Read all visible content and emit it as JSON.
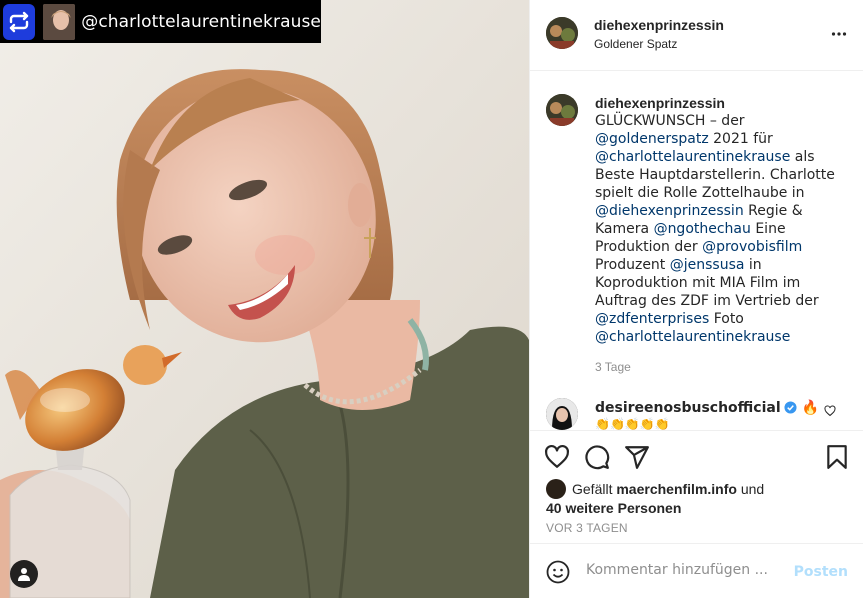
{
  "photo": {
    "repost_handle": "@charlottelaurentinekrause",
    "icons": {
      "repost": "repost-icon",
      "user_tag": "user-icon"
    }
  },
  "header": {
    "username": "diehexenprinzessin",
    "location": "Goldener Spatz",
    "more_icon": "more-horizontal-icon"
  },
  "caption": {
    "username": "diehexenprinzessin",
    "segments": [
      {
        "text": "GLÜCKWUNSCH – der ",
        "mention": false
      },
      {
        "text": "@goldenerspatz",
        "mention": true
      },
      {
        "text": " 2021 für ",
        "mention": false
      },
      {
        "text": "@charlottelaurentinekrause",
        "mention": true
      },
      {
        "text": " als Beste Hauptdarstellerin. Charlotte spielt die Rolle Zottelhaube in ",
        "mention": false
      },
      {
        "text": "@diehexenprinzessin",
        "mention": true
      },
      {
        "text": " Regie & Kamera ",
        "mention": false
      },
      {
        "text": "@ngothechau",
        "mention": true
      },
      {
        "text": " Eine Produktion der ",
        "mention": false
      },
      {
        "text": "@provobisfilm",
        "mention": true
      },
      {
        "text": " Produzent ",
        "mention": false
      },
      {
        "text": "@jenssusa",
        "mention": true
      },
      {
        "text": " in Koproduktion mit MIA Film im Auftrag des ZDF im Vertrieb der ",
        "mention": false
      },
      {
        "text": "@zdfenterprises",
        "mention": true
      },
      {
        "text": " Foto ",
        "mention": false
      },
      {
        "text": "@charlottelaurentinekrause",
        "mention": true
      }
    ],
    "time": "3 Tage"
  },
  "comment": {
    "username": "desireenosbuschofficial",
    "emoji_inline": "🔥",
    "emoji_line": "👏👏👏👏👏"
  },
  "actions": {
    "icons": [
      "heart-icon",
      "comment-icon",
      "share-icon",
      "bookmark-icon"
    ],
    "likes_prefix": "Gefällt ",
    "likes_user": "maerchenfilm.info",
    "likes_mid": " und",
    "likes_others": "40 weitere Personen",
    "date": "VOR 3 TAGEN"
  },
  "add_comment": {
    "placeholder": "Kommentar hinzufügen ...",
    "post_label": "Posten"
  },
  "colors": {
    "mention": "#00376b",
    "verified": "#3897f0",
    "post_button_disabled": "#b2dffc",
    "repost_blue": "#1e3cdc"
  }
}
